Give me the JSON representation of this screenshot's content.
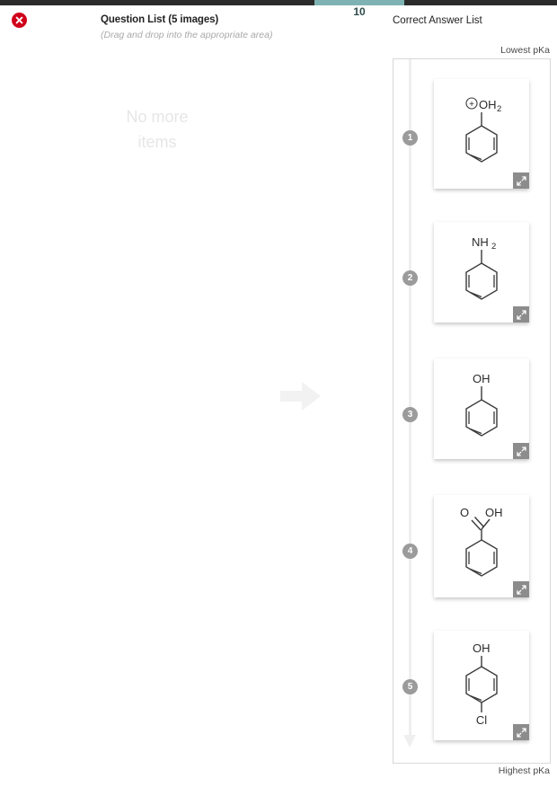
{
  "topbar": {
    "step_number": "10",
    "progress_color": "#7fb3b3",
    "bar_color": "#2b2b2b"
  },
  "close_button": {
    "name": "close",
    "color": "#d0021b"
  },
  "question_panel": {
    "title": "Question List (5 images)",
    "subtitle": "(Drag and drop into the appropriate area)",
    "empty_message_line1": "No more",
    "empty_message_line2": "items"
  },
  "transfer_arrow": {
    "direction": "right",
    "color": "#f2f2f2"
  },
  "answer_panel": {
    "title": "Correct Answer List",
    "top_label": "Lowest pKa",
    "bottom_label": "Highest pKa",
    "badge_color": "#9b9b9b",
    "rail_color": "#efefef",
    "items": [
      {
        "rank": "1",
        "name": "phenoxonium-protonated-phenol",
        "label": "OH",
        "sublabel": "2",
        "charge": "+",
        "substituent_bottom": ""
      },
      {
        "rank": "2",
        "name": "aniline",
        "label": "NH",
        "sublabel": "2",
        "charge": "",
        "substituent_bottom": ""
      },
      {
        "rank": "3",
        "name": "phenol",
        "label": "OH",
        "sublabel": "",
        "charge": "",
        "substituent_bottom": ""
      },
      {
        "rank": "4",
        "name": "benzoic-acid",
        "label": "OH",
        "sublabel": "",
        "charge": "",
        "substituent_bottom": "",
        "carbonyl_label": "O"
      },
      {
        "rank": "5",
        "name": "4-chlorophenol",
        "label": "OH",
        "sublabel": "",
        "charge": "",
        "substituent_bottom": "Cl"
      }
    ]
  }
}
